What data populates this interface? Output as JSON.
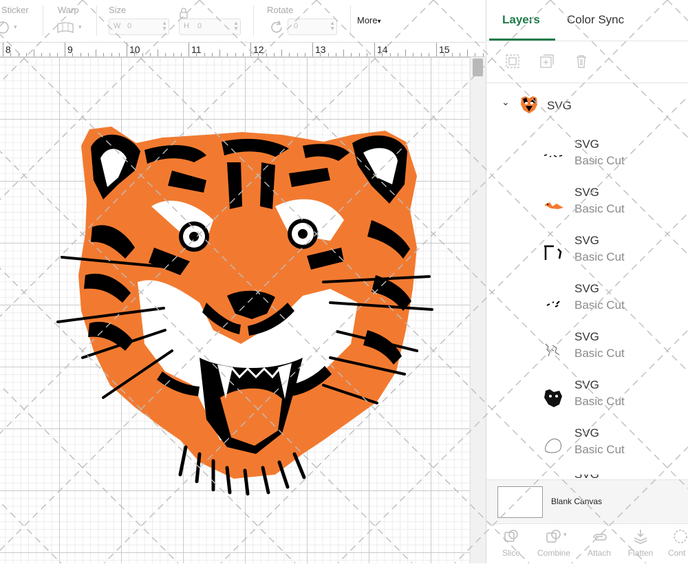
{
  "toolbar": {
    "sticker_label": "Sticker",
    "warp_label": "Warp",
    "size_label": "Size",
    "size_w_prefix": "W",
    "size_w_value": "0",
    "size_h_prefix": "H",
    "size_h_value": "0",
    "rotate_label": "Rotate",
    "rotate_value": "0",
    "more_label": "More"
  },
  "ruler": {
    "numbers": [
      "8",
      "9",
      "10",
      "11",
      "12",
      "13",
      "14",
      "15"
    ]
  },
  "panel": {
    "tabs": [
      {
        "label": "Layers",
        "active": true
      },
      {
        "label": "Color Sync",
        "active": false
      }
    ],
    "group": {
      "name": "SVG"
    },
    "layers": [
      {
        "name": "SVG",
        "op": "Basic Cut"
      },
      {
        "name": "SVG",
        "op": "Basic Cut"
      },
      {
        "name": "SVG",
        "op": "Basic Cut"
      },
      {
        "name": "SVG",
        "op": "Basic Cut"
      },
      {
        "name": "SVG",
        "op": "Basic Cut"
      },
      {
        "name": "SVG",
        "op": "Basic Cut"
      },
      {
        "name": "SVG",
        "op": "Basic Cut"
      }
    ],
    "canvas_label": "Blank Canvas",
    "tools": [
      {
        "label": "Slice",
        "icon": "slice-icon"
      },
      {
        "label": "Combine",
        "icon": "combine-icon"
      },
      {
        "label": "Attach",
        "icon": "attach-icon"
      },
      {
        "label": "Flatten",
        "icon": "flatten-icon"
      },
      {
        "label": "Cont",
        "icon": "contour-icon"
      }
    ]
  },
  "colors": {
    "accent": "#1d7a48",
    "tiger_orange": "#f27a30",
    "ink": "#000000"
  }
}
